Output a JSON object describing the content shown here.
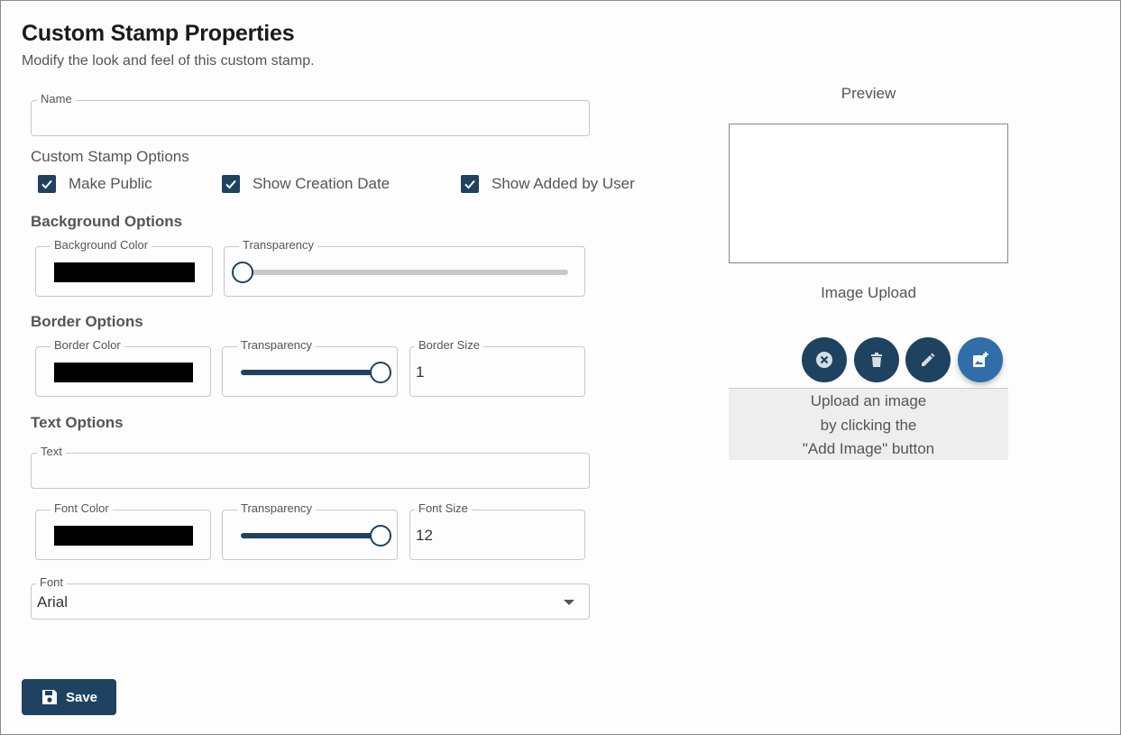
{
  "header": {
    "title": "Custom Stamp Properties",
    "subtitle": "Modify the look and feel of this custom stamp."
  },
  "name_field": {
    "legend": "Name",
    "value": ""
  },
  "stamp_options": {
    "label": "Custom Stamp Options",
    "make_public": {
      "label": "Make Public",
      "checked": true
    },
    "show_creation_date": {
      "label": "Show Creation Date",
      "checked": true
    },
    "show_added_by_user": {
      "label": "Show Added by User",
      "checked": true
    }
  },
  "background": {
    "heading": "Background Options",
    "color_legend": "Background Color",
    "color": "#000000",
    "transparency_legend": "Transparency",
    "transparency": 0
  },
  "border": {
    "heading": "Border Options",
    "color_legend": "Border Color",
    "color": "#000000",
    "transparency_legend": "Transparency",
    "transparency": 1,
    "size_legend": "Border Size",
    "size": "1"
  },
  "text": {
    "heading": "Text Options",
    "text_legend": "Text",
    "text_value": "",
    "color_legend": "Font Color",
    "color": "#000000",
    "transparency_legend": "Transparency",
    "transparency": 1,
    "size_legend": "Font Size",
    "size": "12",
    "font_legend": "Font",
    "font_value": "Arial"
  },
  "preview": {
    "label": "Preview"
  },
  "image_upload": {
    "label": "Image Upload",
    "buttons": [
      "cancel-circle-icon",
      "trash-icon",
      "pencil-icon",
      "add-image-icon"
    ],
    "hint_line1": "Upload an image",
    "hint_line2": "by clicking the",
    "hint_line3": "\"Add Image\" button"
  },
  "footer": {
    "save_label": "Save"
  },
  "colors": {
    "primary": "#1e4260",
    "accent": "#2f6ea8"
  }
}
